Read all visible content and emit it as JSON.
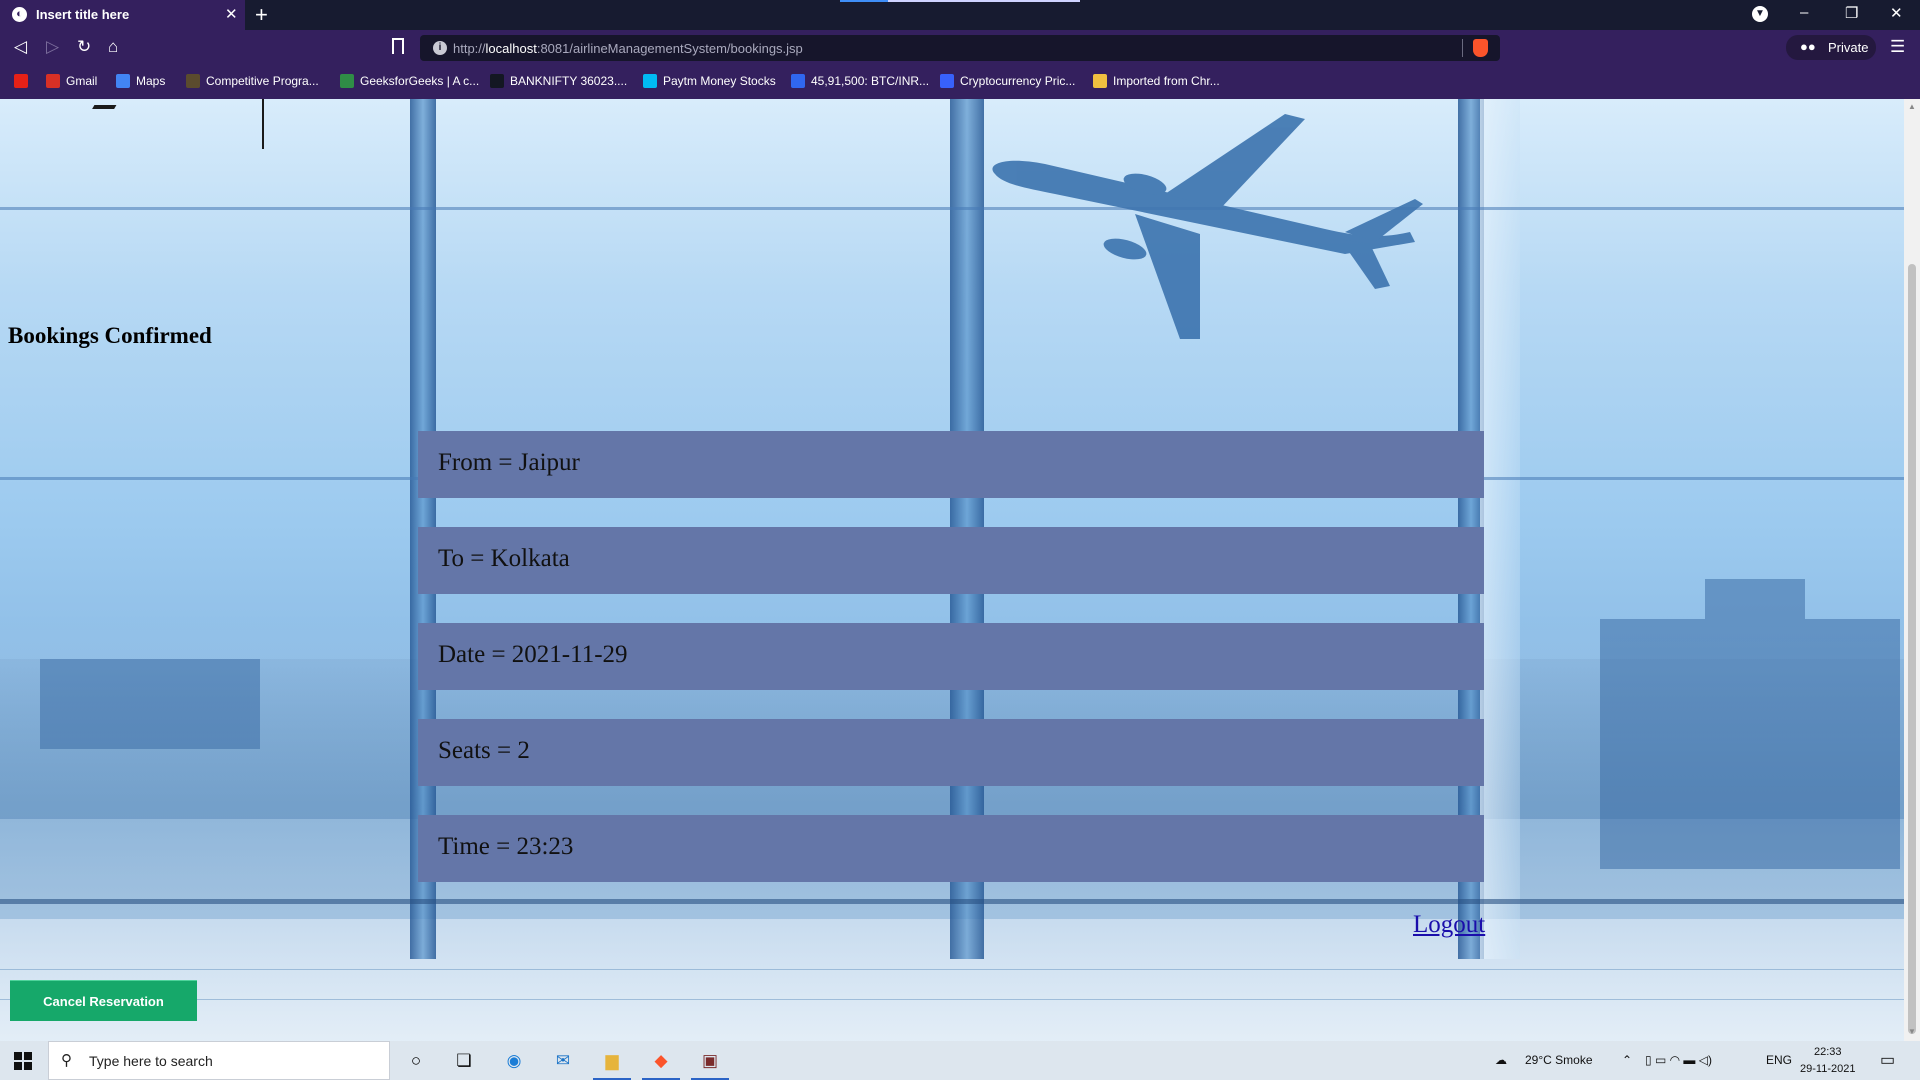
{
  "browser": {
    "tab_title": "Insert title here",
    "url_scheme": "http://",
    "url_host": "localhost",
    "url_rest": ":8081/airlineManagementSystem/bookings.jsp",
    "private_label": "Private",
    "bookmarks": [
      {
        "label": "",
        "icon": "youtube-icon",
        "color": "#e62117"
      },
      {
        "label": "Gmail",
        "icon": "gmail-icon",
        "color": "#d93025"
      },
      {
        "label": "Maps",
        "icon": "google-icon",
        "color": "#4285f4"
      },
      {
        "label": "Competitive Progra...",
        "icon": "cc-icon",
        "color": "#5b4b2e"
      },
      {
        "label": "GeeksforGeeks | A c...",
        "icon": "gfg-icon",
        "color": "#2f8d46"
      },
      {
        "label": "BANKNIFTY 36023....",
        "icon": "tradingview-icon",
        "color": "#131722"
      },
      {
        "label": "Paytm Money Stocks",
        "icon": "paytm-icon",
        "color": "#00baf2"
      },
      {
        "label": "45,91,500: BTC/INR...",
        "icon": "wazirx-icon",
        "color": "#3067f0"
      },
      {
        "label": "Cryptocurrency Pric...",
        "icon": "coin-icon",
        "color": "#3861fb"
      },
      {
        "label": "Imported from Chr...",
        "icon": "folder-icon",
        "color": "#f0c040"
      }
    ]
  },
  "page": {
    "heading": "Bookings Confirmed",
    "rows": [
      "From = Jaipur",
      "To = Kolkata",
      "Date = 2021-11-29",
      "Seats = 2",
      "Time = 23:23"
    ],
    "logout_label": "Logout",
    "cancel_label": "Cancel Reservation"
  },
  "taskbar": {
    "search_placeholder": "Type here to search",
    "weather": "29°C  Smoke",
    "lang": "ENG",
    "time": "22:33",
    "date": "29-11-2021"
  }
}
